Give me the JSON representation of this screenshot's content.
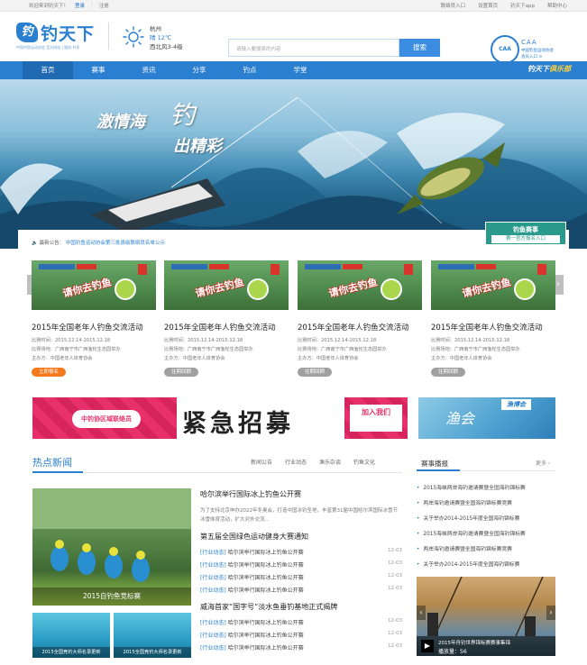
{
  "topbar": {
    "welcome": "欢迎来到钓天下！",
    "login": "登录",
    "separator": "|",
    "register": "注册",
    "links": [
      "联络员入口",
      "设置首页",
      "钓天下app",
      "帮助中心"
    ]
  },
  "header": {
    "logo_mark": "钓",
    "logo_text": "钓天下",
    "logo_tagline": "中国钓鱼运动协会 官方网站 | 服务·共享",
    "weather_city": "杭州",
    "weather_temp": "晴 12℃",
    "weather_wind": "西北风3-4级",
    "search_placeholder": "请输入要搜索的内容",
    "search_button": "搜索",
    "caa_badge": "CAA",
    "caa_title": "CAA",
    "caa_name": "中国钓鱼运动协会",
    "caa_entry": "会员入口 ⊙"
  },
  "nav": {
    "items": [
      "首页",
      "赛事",
      "资讯",
      "分享",
      "钓点",
      "学堂"
    ],
    "active_index": 0,
    "club": {
      "prefix": "钓天下",
      "suffix": "俱乐部"
    }
  },
  "banner": {
    "slogan1": "激情海",
    "slogan_mark": "钓",
    "slogan2": "出精彩"
  },
  "events": {
    "notice_label": "最新公告：",
    "notice_text": "中国钓鱼运动协会第三批县级联络员名单公示",
    "entry_badge": {
      "title": "钓鱼赛事",
      "subtitle": "赛一官方报名入口"
    },
    "cards": [
      {
        "thumb_title": "请你去钓鱼",
        "name": "2015年全国老年人钓鱼交流活动",
        "time": "比赛时间：2015.12.14-2015.12.18",
        "place": "比赛场地：广西南宁市广西渔轮生态园举办",
        "host": "主办方：中国老年人体育协会",
        "button": "立即报名",
        "button_style": "orange"
      },
      {
        "thumb_title": "请你去钓鱼",
        "name": "2015年全国老年人钓鱼交流活动",
        "time": "比赛时间：2015.12.14-2015.12.18",
        "place": "比赛场地：广西南宁市广西渔轮生态园举办",
        "host": "主办方：中国老年人体育协会",
        "button": "往期回顾",
        "button_style": "gray"
      },
      {
        "thumb_title": "请你去钓鱼",
        "name": "2015年全国老年人钓鱼交流活动",
        "time": "比赛时间：2015.12.14-2015.12.18",
        "place": "比赛场地：广西南宁市广西渔轮生态园举办",
        "host": "主办方：中国老年人体育协会",
        "button": "往期回顾",
        "button_style": "gray"
      },
      {
        "thumb_title": "请你去钓鱼",
        "name": "2015年全国老年人钓鱼交流活动",
        "time": "比赛时间：2015.12.14-2015.12.18",
        "place": "比赛场地：广西南宁市广西渔轮生态园举办",
        "host": "主办方：中国老年人体育协会",
        "button": "往期回顾",
        "button_style": "gray"
      }
    ],
    "prev_arrow": "‹",
    "next_arrow": "›"
  },
  "ads": {
    "main": {
      "pill": "中钓协区域联络员",
      "headline": "紧急招募",
      "join": "加入我们"
    },
    "side": {
      "brand": "渔博会",
      "art": "渔会"
    }
  },
  "hot_news": {
    "title": "热点新闻",
    "tabs": [
      "新闻公告",
      "行业动态",
      "渔乐杂谈",
      "钓鱼文化"
    ],
    "photo_caption": "2015自钓鱼竞标赛",
    "thumb_captions": [
      "2015全国竞钓大师名录更新",
      "2015全国竞钓大师名录更新"
    ],
    "headline1": "哈尔滨举行国际冰上钓鱼公开赛",
    "summary1": "为了支持北京申办2022年冬奥会，打造中国冰钓圣地，丰富第31届中国哈尔滨国际冰雪节冰雪体育活动，扩大对外交流...",
    "headline2": "第五届全国绿色运动健身大赛通知",
    "rows1": [
      {
        "cat": "[行业动态]",
        "text": "哈尔滨举行国际冰上钓鱼公开赛",
        "date": "12-03"
      },
      {
        "cat": "[行业动态]",
        "text": "哈尔滨举行国际冰上钓鱼公开赛",
        "date": "12-03"
      },
      {
        "cat": "[行业动态]",
        "text": "哈尔滨举行国际冰上钓鱼公开赛",
        "date": "12-03"
      },
      {
        "cat": "[行业动态]",
        "text": "哈尔滨举行国际冰上钓鱼公开赛",
        "date": "12-03"
      }
    ],
    "headline3": "威海首家“国字号”淡水鱼垂钓基地正式揭牌",
    "rows2": [
      {
        "cat": "[行业动态]",
        "text": "哈尔滨举行国际冰上钓鱼公开赛",
        "date": "12-03"
      },
      {
        "cat": "[行业动态]",
        "text": "哈尔滨举行国际冰上钓鱼公开赛",
        "date": "12-03"
      },
      {
        "cat": "[行业动态]",
        "text": "哈尔滨举行国际冰上钓鱼公开赛",
        "date": "12-03"
      }
    ]
  },
  "report": {
    "title": "赛事播报",
    "more": "更多 ›",
    "items": [
      "2015海峡两岸海钓邀请赛暨全国海钓锦标赛",
      "两岸海钓邀请赛暨全国海钓锦标赛竞赛",
      "关于举办2014-2015年度全国海钓锦标赛",
      "2015海峡两岸海钓邀请赛暨全国海钓锦标赛",
      "两岸海钓邀请赛暨全国海钓锦标赛竞赛",
      "关于举办2014-2015年度全国海钓锦标赛"
    ],
    "video": {
      "play": "▶",
      "title": "2015年舟钓世界锦标赛赛事集锦",
      "views": "播放量：56"
    }
  }
}
